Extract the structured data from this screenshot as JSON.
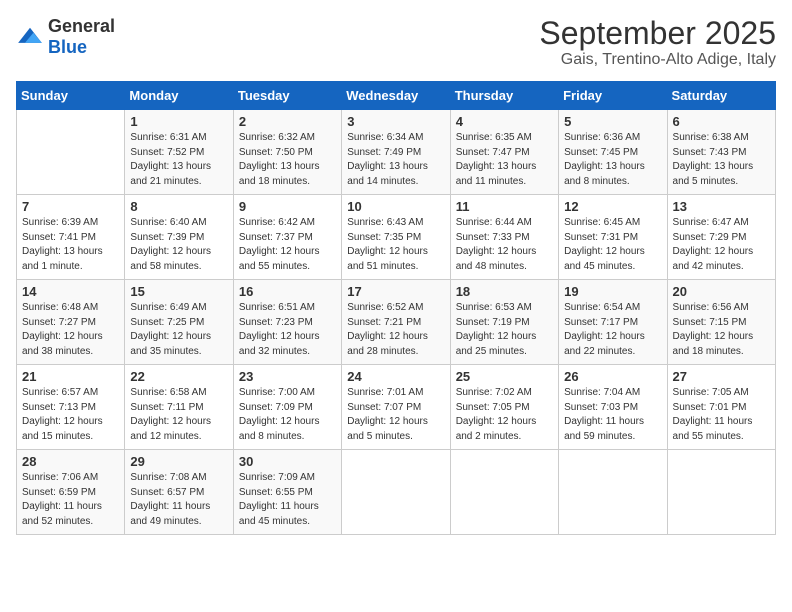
{
  "logo": {
    "general": "General",
    "blue": "Blue"
  },
  "title": "September 2025",
  "subtitle": "Gais, Trentino-Alto Adige, Italy",
  "headers": [
    "Sunday",
    "Monday",
    "Tuesday",
    "Wednesday",
    "Thursday",
    "Friday",
    "Saturday"
  ],
  "weeks": [
    [
      {
        "day": "",
        "info": ""
      },
      {
        "day": "1",
        "info": "Sunrise: 6:31 AM\nSunset: 7:52 PM\nDaylight: 13 hours\nand 21 minutes."
      },
      {
        "day": "2",
        "info": "Sunrise: 6:32 AM\nSunset: 7:50 PM\nDaylight: 13 hours\nand 18 minutes."
      },
      {
        "day": "3",
        "info": "Sunrise: 6:34 AM\nSunset: 7:49 PM\nDaylight: 13 hours\nand 14 minutes."
      },
      {
        "day": "4",
        "info": "Sunrise: 6:35 AM\nSunset: 7:47 PM\nDaylight: 13 hours\nand 11 minutes."
      },
      {
        "day": "5",
        "info": "Sunrise: 6:36 AM\nSunset: 7:45 PM\nDaylight: 13 hours\nand 8 minutes."
      },
      {
        "day": "6",
        "info": "Sunrise: 6:38 AM\nSunset: 7:43 PM\nDaylight: 13 hours\nand 5 minutes."
      }
    ],
    [
      {
        "day": "7",
        "info": "Sunrise: 6:39 AM\nSunset: 7:41 PM\nDaylight: 13 hours\nand 1 minute."
      },
      {
        "day": "8",
        "info": "Sunrise: 6:40 AM\nSunset: 7:39 PM\nDaylight: 12 hours\nand 58 minutes."
      },
      {
        "day": "9",
        "info": "Sunrise: 6:42 AM\nSunset: 7:37 PM\nDaylight: 12 hours\nand 55 minutes."
      },
      {
        "day": "10",
        "info": "Sunrise: 6:43 AM\nSunset: 7:35 PM\nDaylight: 12 hours\nand 51 minutes."
      },
      {
        "day": "11",
        "info": "Sunrise: 6:44 AM\nSunset: 7:33 PM\nDaylight: 12 hours\nand 48 minutes."
      },
      {
        "day": "12",
        "info": "Sunrise: 6:45 AM\nSunset: 7:31 PM\nDaylight: 12 hours\nand 45 minutes."
      },
      {
        "day": "13",
        "info": "Sunrise: 6:47 AM\nSunset: 7:29 PM\nDaylight: 12 hours\nand 42 minutes."
      }
    ],
    [
      {
        "day": "14",
        "info": "Sunrise: 6:48 AM\nSunset: 7:27 PM\nDaylight: 12 hours\nand 38 minutes."
      },
      {
        "day": "15",
        "info": "Sunrise: 6:49 AM\nSunset: 7:25 PM\nDaylight: 12 hours\nand 35 minutes."
      },
      {
        "day": "16",
        "info": "Sunrise: 6:51 AM\nSunset: 7:23 PM\nDaylight: 12 hours\nand 32 minutes."
      },
      {
        "day": "17",
        "info": "Sunrise: 6:52 AM\nSunset: 7:21 PM\nDaylight: 12 hours\nand 28 minutes."
      },
      {
        "day": "18",
        "info": "Sunrise: 6:53 AM\nSunset: 7:19 PM\nDaylight: 12 hours\nand 25 minutes."
      },
      {
        "day": "19",
        "info": "Sunrise: 6:54 AM\nSunset: 7:17 PM\nDaylight: 12 hours\nand 22 minutes."
      },
      {
        "day": "20",
        "info": "Sunrise: 6:56 AM\nSunset: 7:15 PM\nDaylight: 12 hours\nand 18 minutes."
      }
    ],
    [
      {
        "day": "21",
        "info": "Sunrise: 6:57 AM\nSunset: 7:13 PM\nDaylight: 12 hours\nand 15 minutes."
      },
      {
        "day": "22",
        "info": "Sunrise: 6:58 AM\nSunset: 7:11 PM\nDaylight: 12 hours\nand 12 minutes."
      },
      {
        "day": "23",
        "info": "Sunrise: 7:00 AM\nSunset: 7:09 PM\nDaylight: 12 hours\nand 8 minutes."
      },
      {
        "day": "24",
        "info": "Sunrise: 7:01 AM\nSunset: 7:07 PM\nDaylight: 12 hours\nand 5 minutes."
      },
      {
        "day": "25",
        "info": "Sunrise: 7:02 AM\nSunset: 7:05 PM\nDaylight: 12 hours\nand 2 minutes."
      },
      {
        "day": "26",
        "info": "Sunrise: 7:04 AM\nSunset: 7:03 PM\nDaylight: 11 hours\nand 59 minutes."
      },
      {
        "day": "27",
        "info": "Sunrise: 7:05 AM\nSunset: 7:01 PM\nDaylight: 11 hours\nand 55 minutes."
      }
    ],
    [
      {
        "day": "28",
        "info": "Sunrise: 7:06 AM\nSunset: 6:59 PM\nDaylight: 11 hours\nand 52 minutes."
      },
      {
        "day": "29",
        "info": "Sunrise: 7:08 AM\nSunset: 6:57 PM\nDaylight: 11 hours\nand 49 minutes."
      },
      {
        "day": "30",
        "info": "Sunrise: 7:09 AM\nSunset: 6:55 PM\nDaylight: 11 hours\nand 45 minutes."
      },
      {
        "day": "",
        "info": ""
      },
      {
        "day": "",
        "info": ""
      },
      {
        "day": "",
        "info": ""
      },
      {
        "day": "",
        "info": ""
      }
    ]
  ]
}
